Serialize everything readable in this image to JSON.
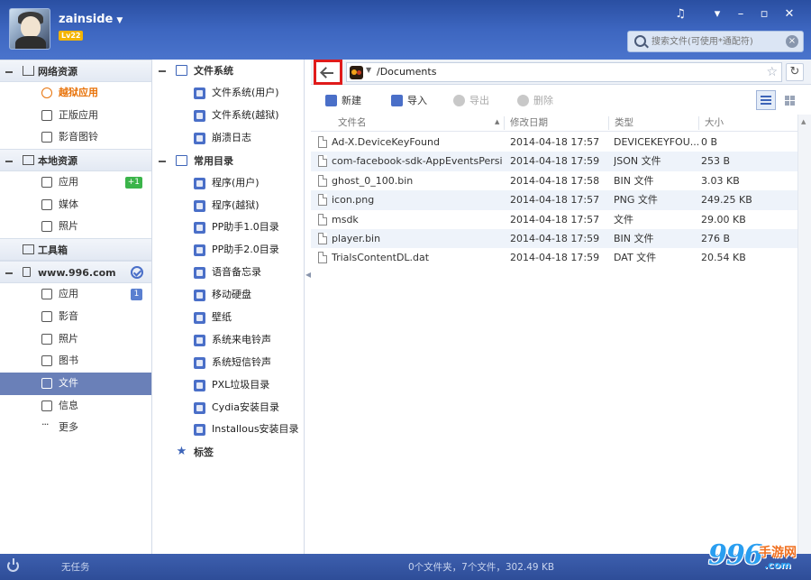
{
  "header": {
    "username": "zainside",
    "level": "Lv22",
    "search": {
      "placeholder": "搜索文件(可使用*通配符)"
    },
    "window_controls": [
      "music-icon",
      "menu-icon",
      "minimize-icon",
      "maximize-icon",
      "close-icon"
    ]
  },
  "sidebar": {
    "sections": [
      {
        "title": "网络资源",
        "icon": "home-icon",
        "items": [
          {
            "label": "越狱应用",
            "icon": "pp-icon",
            "style": "orange"
          },
          {
            "label": "正版应用",
            "icon": "thumb-icon"
          },
          {
            "label": "影音图铃",
            "icon": "music-note-icon"
          }
        ]
      },
      {
        "title": "本地资源",
        "icon": "monitor-icon",
        "items": [
          {
            "label": "应用",
            "icon": "apps-icon",
            "badge": "+1"
          },
          {
            "label": "媒体",
            "icon": "video-icon"
          },
          {
            "label": "照片",
            "icon": "photo-icon"
          }
        ]
      },
      {
        "title": "工具箱",
        "icon": "toolbox-icon",
        "items": []
      },
      {
        "title": "www.996.com",
        "icon": "phone-icon",
        "items": [
          {
            "label": "应用",
            "icon": "apps-icon",
            "badge": "1"
          },
          {
            "label": "影音",
            "icon": "video-icon"
          },
          {
            "label": "照片",
            "icon": "photo-icon"
          },
          {
            "label": "图书",
            "icon": "book-icon"
          },
          {
            "label": "文件",
            "icon": "file-icon",
            "active": true
          },
          {
            "label": "信息",
            "icon": "message-icon"
          },
          {
            "label": "更多",
            "icon": "more-icon"
          }
        ]
      }
    ]
  },
  "tree": {
    "filesystem": {
      "title": "文件系统",
      "items": [
        "文件系统(用户)",
        "文件系统(越狱)",
        "崩溃日志"
      ]
    },
    "common": {
      "title": "常用目录",
      "items": [
        "程序(用户)",
        "程序(越狱)",
        "PP助手1.0目录",
        "PP助手2.0目录",
        "语音备忘录",
        "移动硬盘",
        "壁纸",
        "系统来电铃声",
        "系统短信铃声",
        "PXL垃圾目录",
        "Cydia安装目录",
        "Installous安装目录"
      ]
    },
    "bookmarks": {
      "title": "标签"
    }
  },
  "addressbar": {
    "path": "/Documents"
  },
  "toolbar": {
    "new": "新建",
    "import": "导入",
    "export": "导出",
    "delete": "删除"
  },
  "table": {
    "columns": [
      "文件名",
      "修改日期",
      "类型",
      "大小"
    ],
    "rows": [
      {
        "name": "Ad-X.DeviceKeyFound",
        "date": "2014-04-18 17:57",
        "type": "DEVICEKEYFOU...",
        "size": "0 B"
      },
      {
        "name": "com-facebook-sdk-AppEventsPersi...",
        "date": "2014-04-18 17:59",
        "type": "JSON 文件",
        "size": "253 B"
      },
      {
        "name": "ghost_0_100.bin",
        "date": "2014-04-18 17:58",
        "type": "BIN 文件",
        "size": "3.03 KB"
      },
      {
        "name": "icon.png",
        "date": "2014-04-18 17:57",
        "type": "PNG 文件",
        "size": "249.25 KB"
      },
      {
        "name": "msdk",
        "date": "2014-04-18 17:57",
        "type": "文件",
        "size": "29.00 KB"
      },
      {
        "name": "player.bin",
        "date": "2014-04-18 17:59",
        "type": "BIN 文件",
        "size": "276 B"
      },
      {
        "name": "TrialsContentDL.dat",
        "date": "2014-04-18 17:59",
        "type": "DAT 文件",
        "size": "20.54 KB"
      }
    ]
  },
  "footer": {
    "task_label": "无任务",
    "status": "0个文件夹，7个文件，302.49 KB"
  },
  "watermark": {
    "num": "996",
    "txt": "手游网",
    "com": ".com"
  },
  "colors": {
    "header": "#2a4fa2",
    "active_item": "#6a80b8",
    "accent": "#3d64b8",
    "highlight_box": "#e01b1b",
    "orange": "#e8730a"
  }
}
